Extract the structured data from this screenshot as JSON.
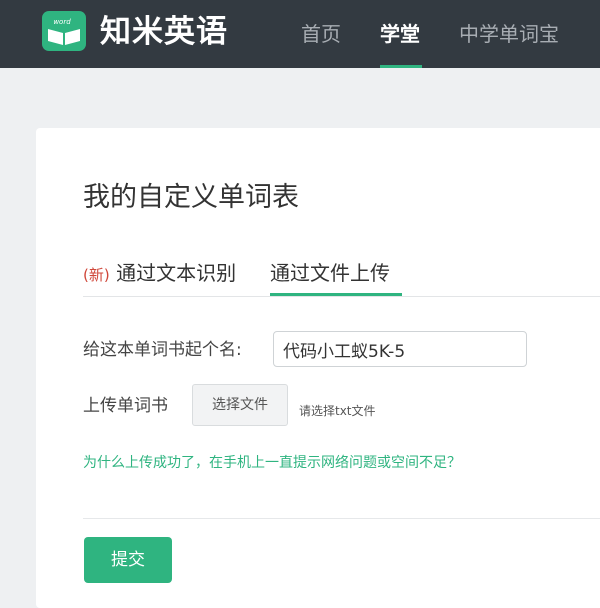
{
  "header": {
    "logo_icon": "book-icon",
    "logo_text": "word",
    "brand_name": "知米英语",
    "nav": [
      {
        "label": "首页",
        "active": false
      },
      {
        "label": "学堂",
        "active": true
      },
      {
        "label": "中学单词宝",
        "active": false
      }
    ]
  },
  "main": {
    "title": "我的自定义单词表",
    "tabs": [
      {
        "badge": "(新)",
        "label": "通过文本识别",
        "active": false
      },
      {
        "label": "通过文件上传",
        "active": true
      }
    ],
    "form": {
      "name_label": "给这本单词书起个名:",
      "name_value": "代码小工蚁5K-5",
      "upload_label": "上传单词书",
      "file_button_label": "选择文件",
      "file_hint": "请选择txt文件",
      "help_link": "为什么上传成功了，在手机上一直提示网络问题或空间不足？",
      "submit_label": "提交"
    }
  },
  "colors": {
    "accent": "#2fb480",
    "header_bg": "#333a41",
    "new_badge": "#d0473a"
  }
}
